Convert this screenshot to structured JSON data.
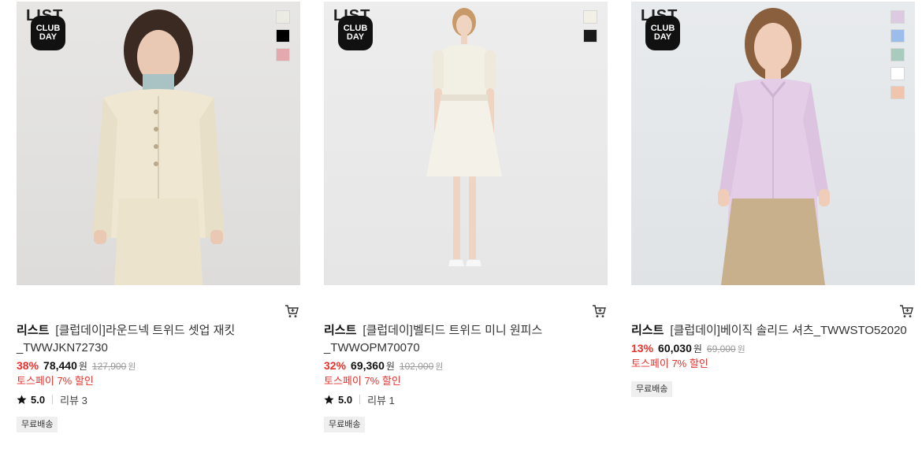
{
  "products": [
    {
      "brand_mark": "LIST",
      "badge": {
        "line1": "CLUB",
        "line2": "DAY"
      },
      "swatches": [
        "#ecebe3",
        "#000000",
        "#e3a9ad"
      ],
      "brand": "리스트",
      "name": "[클럽데이]라운드넥 트위드 셋업 재킷_TWWJKN72730",
      "discount": "38%",
      "sale_price": "78,440",
      "currency": "원",
      "original_price": "127,900",
      "original_currency": "원",
      "promo": "토스페이 7% 할인",
      "rating": "5.0",
      "review": "리뷰 3",
      "shipping": "무료배송"
    },
    {
      "brand_mark": "LIST",
      "badge": {
        "line1": "CLUB",
        "line2": "DAY"
      },
      "swatches": [
        "#f1efe6",
        "#1b1b1b"
      ],
      "brand": "리스트",
      "name": "[클럽데이]벨티드 트위드 미니 원피스_TWWOPM70070",
      "discount": "32%",
      "sale_price": "69,360",
      "currency": "원",
      "original_price": "102,000",
      "original_currency": "원",
      "promo": "토스페이 7% 할인",
      "rating": "5.0",
      "review": "리뷰 1",
      "shipping": "무료배송"
    },
    {
      "brand_mark": "LIST",
      "badge": {
        "line1": "CLUB",
        "line2": "DAY"
      },
      "swatches": [
        "#dccbe0",
        "#9cbcec",
        "#a9cbbd",
        "#ffffff",
        "#f1c5ad"
      ],
      "brand": "리스트",
      "name": "[클럽데이]베이직 솔리드 셔츠_TWWSTO52020",
      "discount": "13%",
      "sale_price": "60,030",
      "currency": "원",
      "original_price": "69,000",
      "original_currency": "원",
      "promo": "토스페이 7% 할인",
      "shipping": "무료배송"
    }
  ],
  "icons": {
    "cart": "cart-plus-icon",
    "star": "star-icon"
  }
}
